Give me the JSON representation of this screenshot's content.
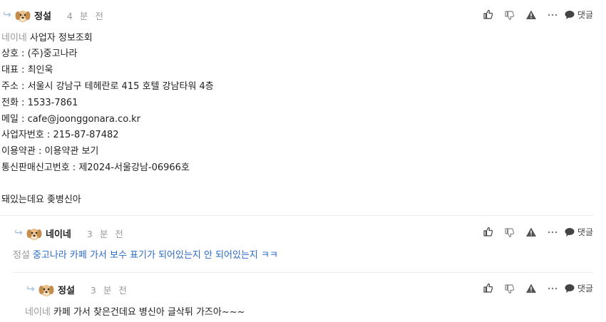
{
  "comment1": {
    "author": "정설",
    "time": "4 분 전",
    "reply_label": "댓글",
    "mention": "네이네",
    "lines": [
      "사업자 정보조회",
      "상호 : (주)중고나라",
      "대표 : 최인욱",
      "주소 : 서울시 강남구 테헤란로 415 호텔 강남타워 4층",
      "전화 : 1533-7861",
      "메일 : cafe@joonggonara.co.kr",
      "사업자번호 : 215-87-87482",
      "이용약관 : 이용약관 보기",
      "통신판매신고번호 : 제2024-서울강남-06966호",
      "",
      "돼있는데요 좆병신아"
    ]
  },
  "comment2": {
    "author": "네이네",
    "time": "3 분 전",
    "reply_label": "댓글",
    "mention": "정설",
    "text": "중고나라 카페 가서 보수 표기가 되어있는지 안 되어있는지 ㅋㅋ"
  },
  "comment3": {
    "author": "정설",
    "time": "3 분 전",
    "reply_label": "댓글",
    "mention": "네이네",
    "text": "카페 가서 찾은건데요 병신아 글삭튀 가즈아~~~"
  },
  "colors": {
    "mention": "#999999",
    "link_text": "#2a6ac8",
    "reply_arrow": "#9bbbe0"
  },
  "icons": [
    "reply-arrow-icon",
    "dog-avatar-icon",
    "thumbs-up-icon",
    "thumbs-down-icon",
    "warning-icon",
    "more-icon",
    "speech-bubble-icon"
  ]
}
